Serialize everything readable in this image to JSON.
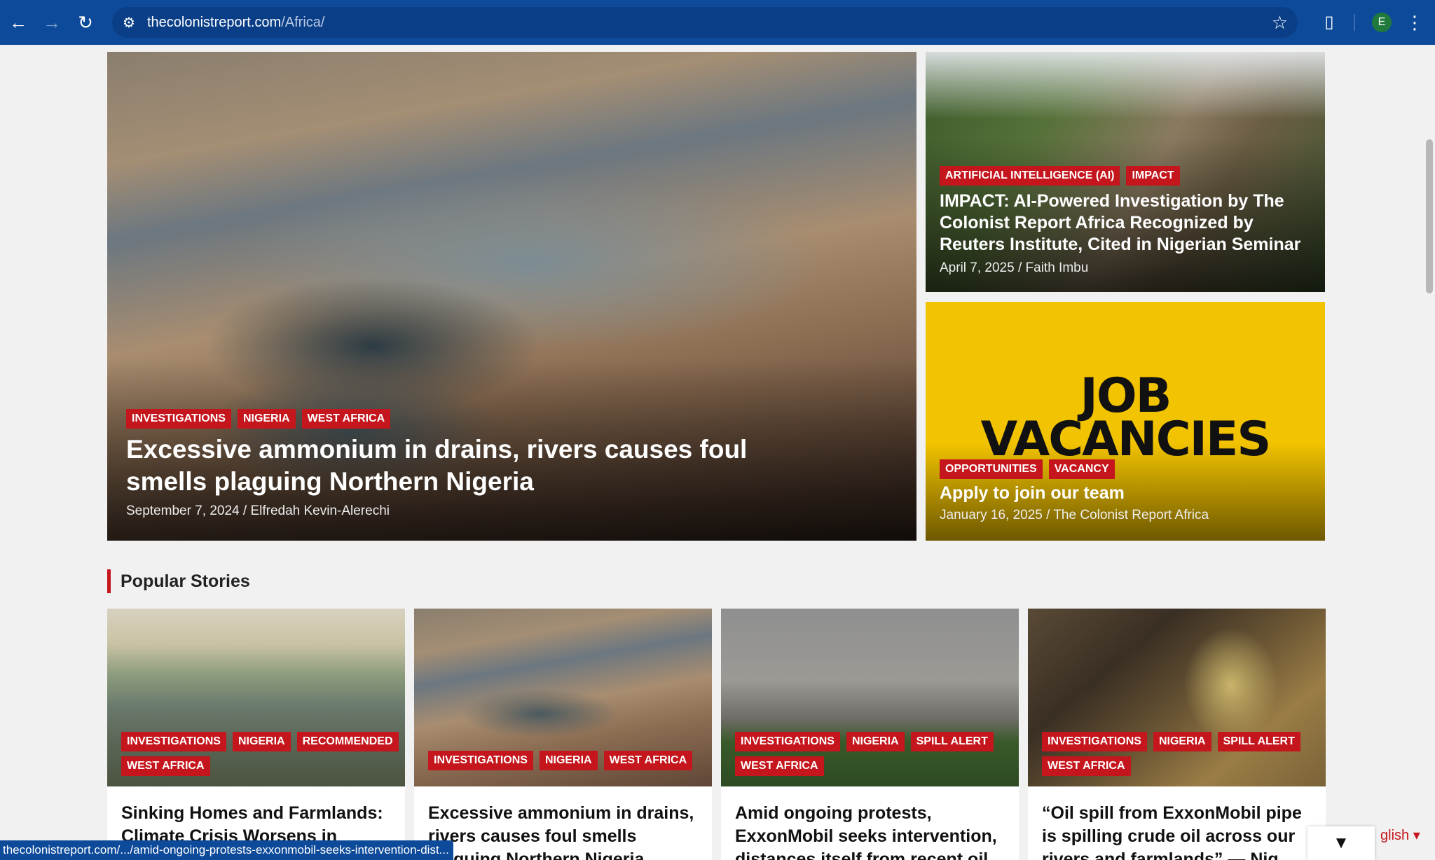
{
  "browser": {
    "url_domain": "thecolonistreport.com",
    "url_path": "/Africa/",
    "profile_initial": "E",
    "status_url": "thecolonistreport.com/.../amid-ongoing-protests-exxonmobil-seeks-intervention-dist..."
  },
  "featured": {
    "main": {
      "tags": [
        "INVESTIGATIONS",
        "NIGERIA",
        "WEST AFRICA"
      ],
      "title": "Excessive ammonium in drains, rivers causes foul smells plaguing Northern Nigeria",
      "meta": "September 7, 2024 / Elfredah Kevin-Alerechi"
    },
    "ai": {
      "tags": [
        "ARTIFICIAL INTELLIGENCE (AI)",
        "IMPACT"
      ],
      "title": "IMPACT: AI-Powered Investigation by The Colonist Report Africa Recognized by Reuters Institute, Cited in Nigerian Seminar",
      "meta": "April 7, 2025 / Faith Imbu"
    },
    "job": {
      "image_text_1": "JOB",
      "image_text_2": "VACANCIES",
      "tags": [
        "OPPORTUNITIES",
        "VACANCY"
      ],
      "title": "Apply to join our team",
      "meta": "January 16, 2025 / The Colonist Report Africa"
    }
  },
  "popular": {
    "heading": "Popular Stories",
    "stories": [
      {
        "tags": [
          "INVESTIGATIONS",
          "NIGERIA",
          "RECOMMENDED",
          "WEST AFRICA"
        ],
        "title": "Sinking Homes and Farmlands: Climate Crisis Worsens in"
      },
      {
        "tags": [
          "INVESTIGATIONS",
          "NIGERIA",
          "WEST AFRICA"
        ],
        "title": "Excessive ammonium in drains, rivers causes foul smells plaguing Northern Nigeria"
      },
      {
        "tags": [
          "INVESTIGATIONS",
          "NIGERIA",
          "SPILL ALERT",
          "WEST AFRICA"
        ],
        "title": "Amid ongoing protests, ExxonMobil seeks intervention, distances itself from recent oil"
      },
      {
        "tags": [
          "INVESTIGATIONS",
          "NIGERIA",
          "SPILL ALERT",
          "WEST AFRICA"
        ],
        "title": "“Oil spill from ExxonMobil pipe is spilling crude oil across our rivers and farmlands” — Nig"
      }
    ]
  },
  "language": {
    "label": "glish ▾"
  },
  "icons": {
    "back": "back-arrow-icon",
    "forward": "forward-arrow-icon",
    "reload": "reload-icon",
    "site": "site-settings-icon",
    "bookmark": "star-icon",
    "extensions": "puzzle-icon",
    "menu": "kebab-menu-icon",
    "scroll": "chevron-down-icon"
  },
  "colors": {
    "chrome": "#0d4a9a",
    "tag_red": "#c4161c",
    "job_yellow": "#f2c300"
  }
}
